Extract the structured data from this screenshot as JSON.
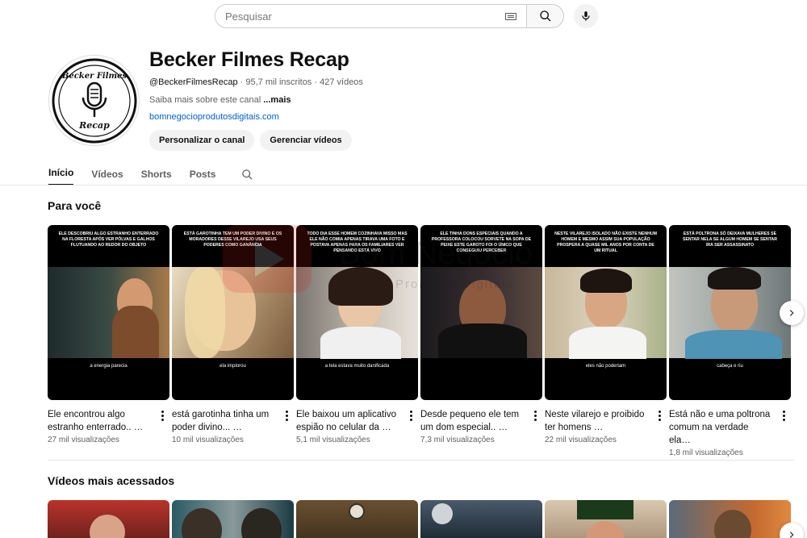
{
  "search": {
    "placeholder": "Pesquisar"
  },
  "channel": {
    "logo_text_top": "Becker Filmes",
    "logo_text_bottom": "Recap",
    "name": "Becker Filmes Recap",
    "handle": "@BeckerFilmesRecap",
    "subscribers": "95,7 mil inscritos",
    "videos_count": "427 vídeos",
    "separator": "·",
    "description": "Saiba mais sobre este canal",
    "more": "...mais",
    "link": "bomnegocioprodutosdigitais.com",
    "buttons": {
      "customize": "Personalizar o canal",
      "manage": "Gerenciar vídeos"
    }
  },
  "tabs": [
    "Início",
    "Vídeos",
    "Shorts",
    "Posts"
  ],
  "watermark": {
    "line1": "Bom Negócio",
    "line2": "Produtos Digitais"
  },
  "sections": {
    "for_you": {
      "title": "Para você",
      "cards": [
        {
          "caption": "Ele descobriu algo estranho enterrado na floresta após ver pólvas e galhos flutuando ao redor do objeto",
          "subtitle": "a energia parecia",
          "title": "Ele encontrou algo estranho enterrado.. …",
          "views": "27 mil visualizações"
        },
        {
          "caption": "Está garotinha tem um poder divino e os moradores desse vilarejo usa seus poderes como ganância",
          "subtitle": "ela implorou",
          "title": "está garotinha tinha um poder divino... …",
          "views": "10 mil visualizações"
        },
        {
          "caption": "Todo dia esse homem cozinhava misso mas ele não comia apenas tirava uma foto e postava apenas para os familiares ver pensando está vivo",
          "subtitle": "a tela estava muito danificada",
          "title": "Ele baixou um aplicativo espião no celular da …",
          "views": "5,1 mil visualizações"
        },
        {
          "caption": "Ele tinha dons especiais quando a professora colocou sorvete na sopa de peixe este garoto foi o único que conseguiu perceber",
          "subtitle": "",
          "title": "Desde pequeno ele tem um dom especial.. …",
          "views": "7,3 mil visualizações"
        },
        {
          "caption": "Neste vilarejo isolado não existe nenhum homem e mesmo assim sua população prospera a quase mil anos por conta de um ritual",
          "subtitle": "eles não poderiam",
          "title": "Neste vilarejo e proibido ter homens …",
          "views": "22 mil visualizações"
        },
        {
          "caption": "Está poltrona só deixava mulheres se sentar nela se algum homem se sentar ira ser assassinato",
          "subtitle": "cabeça e riu",
          "title": "Está não e uma poltrona comum na verdade ela…",
          "views": "1,8 mil visualizações"
        }
      ]
    },
    "most_watched": {
      "title": "Vídeos mais acessados"
    }
  },
  "colors": {
    "link": "#065fd4",
    "text": "#0f0f0f",
    "muted": "#606060",
    "chip": "#f2f2f2"
  },
  "icons": [
    "keyboard-icon",
    "search-icon",
    "mic-icon",
    "search-tab-icon",
    "chevron-right-icon",
    "more-vert-icon"
  ]
}
